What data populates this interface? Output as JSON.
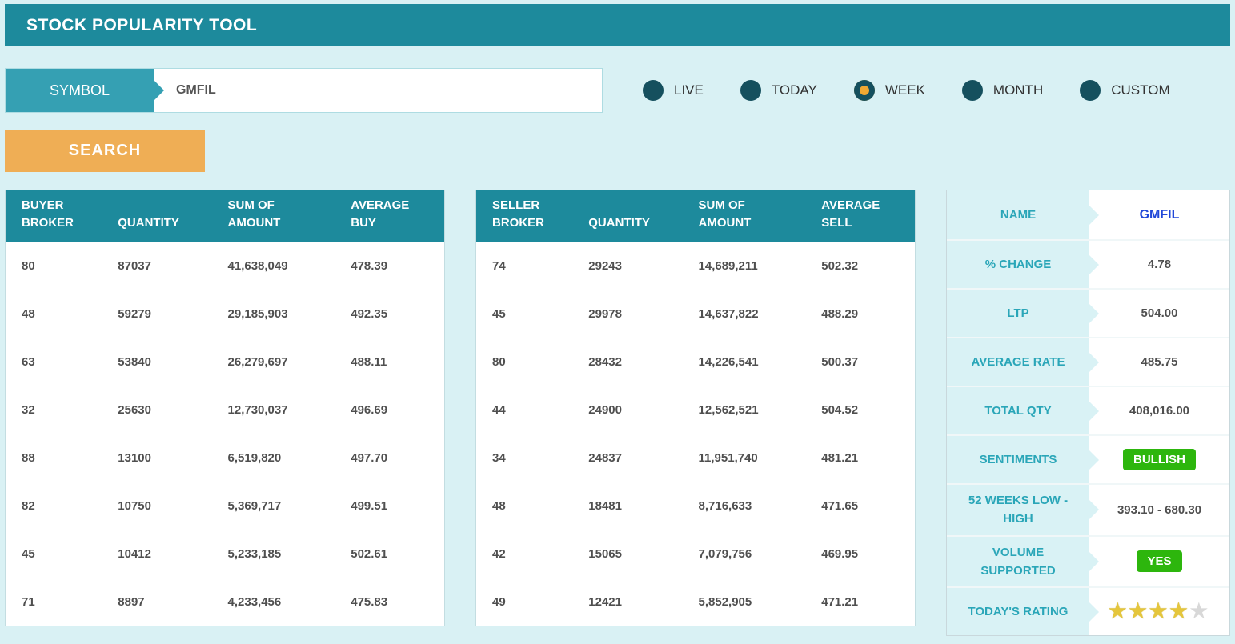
{
  "header": {
    "title": "STOCK POPULARITY TOOL"
  },
  "search": {
    "symbol_label": "SYMBOL",
    "symbol_value": "GMFIL",
    "button_label": "SEARCH",
    "periods": [
      {
        "label": "LIVE",
        "selected": false
      },
      {
        "label": "TODAY",
        "selected": false
      },
      {
        "label": "WEEK",
        "selected": true
      },
      {
        "label": "MONTH",
        "selected": false
      },
      {
        "label": "CUSTOM",
        "selected": false
      }
    ]
  },
  "buyer_table": {
    "headers": [
      [
        "BUYER",
        "BROKER"
      ],
      [
        "QUANTITY"
      ],
      [
        "SUM OF",
        "AMOUNT"
      ],
      [
        "AVERAGE",
        "BUY"
      ]
    ],
    "rows": [
      [
        "80",
        "87037",
        "41,638,049",
        "478.39"
      ],
      [
        "48",
        "59279",
        "29,185,903",
        "492.35"
      ],
      [
        "63",
        "53840",
        "26,279,697",
        "488.11"
      ],
      [
        "32",
        "25630",
        "12,730,037",
        "496.69"
      ],
      [
        "88",
        "13100",
        "6,519,820",
        "497.70"
      ],
      [
        "82",
        "10750",
        "5,369,717",
        "499.51"
      ],
      [
        "45",
        "10412",
        "5,233,185",
        "502.61"
      ],
      [
        "71",
        "8897",
        "4,233,456",
        "475.83"
      ]
    ]
  },
  "seller_table": {
    "headers": [
      [
        "SELLER",
        "BROKER"
      ],
      [
        "QUANTITY"
      ],
      [
        "SUM OF",
        "AMOUNT"
      ],
      [
        "AVERAGE",
        "SELL"
      ]
    ],
    "rows": [
      [
        "74",
        "29243",
        "14,689,211",
        "502.32"
      ],
      [
        "45",
        "29978",
        "14,637,822",
        "488.29"
      ],
      [
        "80",
        "28432",
        "14,226,541",
        "500.37"
      ],
      [
        "44",
        "24900",
        "12,562,521",
        "504.52"
      ],
      [
        "34",
        "24837",
        "11,951,740",
        "481.21"
      ],
      [
        "48",
        "18481",
        "8,716,633",
        "471.65"
      ],
      [
        "42",
        "15065",
        "7,079,756",
        "469.95"
      ],
      [
        "49",
        "12421",
        "5,852,905",
        "471.21"
      ]
    ]
  },
  "summary": {
    "rows": [
      {
        "label": "NAME",
        "value": "GMFIL",
        "type": "link"
      },
      {
        "label": "% CHANGE",
        "value": "4.78",
        "type": "text"
      },
      {
        "label": "LTP",
        "value": "504.00",
        "type": "text"
      },
      {
        "label": "AVERAGE RATE",
        "value": "485.75",
        "type": "text"
      },
      {
        "label": "TOTAL QTY",
        "value": "408,016.00",
        "type": "text"
      },
      {
        "label": "SENTIMENTS",
        "value": "BULLISH",
        "type": "badge"
      },
      {
        "label": "52 WEEKS LOW - HIGH",
        "value": "393.10 - 680.30",
        "type": "text"
      },
      {
        "label": "VOLUME SUPPORTED",
        "value": "YES",
        "type": "badge"
      },
      {
        "label": "TODAY'S RATING",
        "value": "4/5",
        "type": "stars",
        "filled": 4,
        "total": 5
      }
    ]
  },
  "colors": {
    "header_teal": "#1d8a9c",
    "symbol_label_teal": "#35a0b3",
    "accent_orange": "#efae55",
    "selected_radio_orange": "#f0a832",
    "radio_dark_teal": "#15505e",
    "badge_green": "#2db60d",
    "link_blue": "#2148d8",
    "star_gold": "#e5c63c",
    "panel_label_bg": "#d9f2f5",
    "panel_label_text": "#2aa6b8",
    "page_background": "#d9f1f4"
  }
}
